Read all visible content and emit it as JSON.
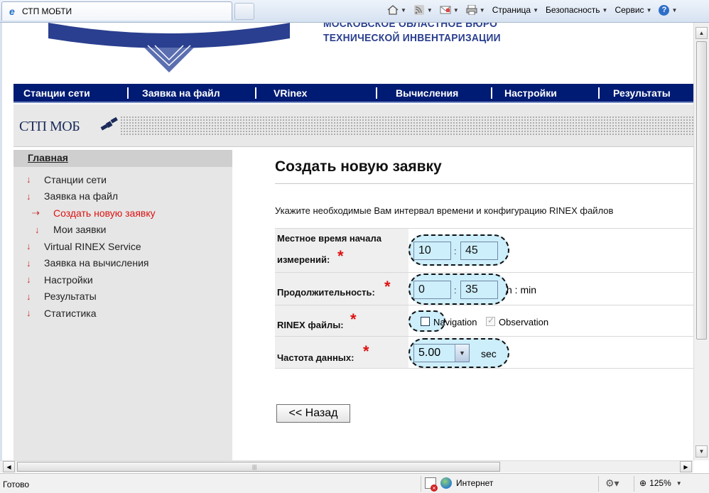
{
  "browser": {
    "tab_title": "СТП МОБТИ",
    "commands": {
      "page": "Страница",
      "security": "Безопасность",
      "service": "Сервис",
      "help": "?"
    },
    "status": "Готово",
    "zone": "Интернет",
    "zoom": "125%"
  },
  "header": {
    "org_line1": "МОСКОВСКОЕ ОБЛАСТНОЕ БЮРО",
    "org_line2": "ТЕХНИЧЕСКОЙ ИНВЕНТАРИЗАЦИИ",
    "brand": "СТП МОБ"
  },
  "nav": {
    "items": [
      "Станции сети",
      "Заявка на файл",
      "VRinex",
      "Вычисления",
      "Настройки",
      "Результаты"
    ]
  },
  "sidebar": {
    "heading": "Главная",
    "items": [
      {
        "label": "Станции сети"
      },
      {
        "label": "Заявка на файл"
      },
      {
        "label": "Создать новую заявку"
      },
      {
        "label": "Мои заявки"
      },
      {
        "label": "Virtual RINEX Service"
      },
      {
        "label": "Заявка на вычисления"
      },
      {
        "label": "Настройки"
      },
      {
        "label": "Результаты"
      },
      {
        "label": "Статистика"
      }
    ]
  },
  "main": {
    "title": "Создать новую заявку",
    "instruction": "Укажите необходимые Вам интервал времени и конфигурацию RINEX файлов",
    "form": {
      "start_label_1": "Местное время начала",
      "start_label_2": "измерений:",
      "start_hour": "10",
      "start_min": "45",
      "duration_label": "Продолжительность:",
      "duration_hour": "0",
      "duration_min": "35",
      "duration_unit": "h : min",
      "rinex_label": "RINEX файлы:",
      "navigation": "Navigation",
      "observation": "Observation",
      "rate_label": "Частота данных:",
      "rate_value": "5.00",
      "rate_unit": "sec",
      "separator": ":",
      "required_mark": "*"
    },
    "back_button": "<< Назад"
  }
}
